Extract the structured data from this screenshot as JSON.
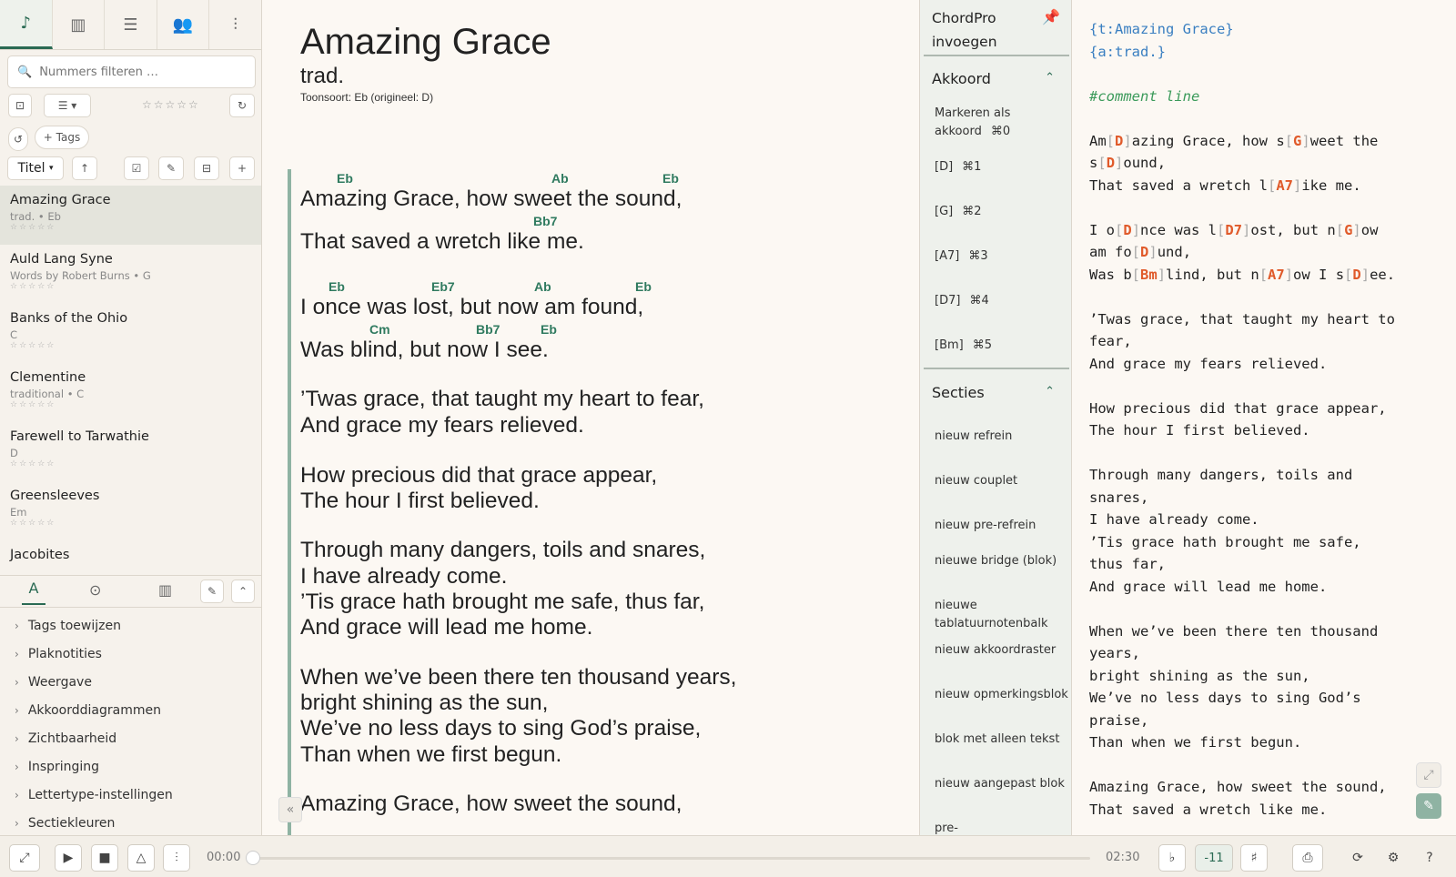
{
  "nav_tabs": [
    {
      "icon": "music-note-icon"
    },
    {
      "icon": "piano-icon"
    },
    {
      "icon": "playlist-icon"
    },
    {
      "icon": "people-icon"
    },
    {
      "icon": "sliders-icon"
    }
  ],
  "search": {
    "placeholder": "Nummers filteren …"
  },
  "toolbar": {
    "tags_label": "+ Tags",
    "sort_label": "Titel"
  },
  "songs": [
    {
      "title": "Amazing Grace",
      "meta": "trad. • Eb",
      "stars": "☆☆☆☆☆"
    },
    {
      "title": "Auld Lang Syne",
      "meta": "Words by Robert Burns • G",
      "stars": "☆☆☆☆☆"
    },
    {
      "title": "Banks of the Ohio",
      "meta": "C",
      "stars": "☆☆☆☆☆"
    },
    {
      "title": "Clementine",
      "meta": "traditional • C",
      "stars": "☆☆☆☆☆"
    },
    {
      "title": "Farewell to Tarwathie",
      "meta": "D",
      "stars": "☆☆☆☆☆"
    },
    {
      "title": "Greensleeves",
      "meta": "Em",
      "stars": "☆☆☆☆☆"
    },
    {
      "title": "Jacobites",
      "meta": "",
      "stars": ""
    }
  ],
  "properties": [
    "Tags toewijzen",
    "Plaknotities",
    "Weergave",
    "Akkoorddiagrammen",
    "Zichtbaarheid",
    "Inspringing",
    "Lettertype-instellingen",
    "Sectiekleuren"
  ],
  "sheet": {
    "title": "Amazing Grace",
    "artist": "trad.",
    "key": "Toonsoort: Eb (origineel: D)",
    "lines": [
      {
        "text": "Amazing Grace, how sweet the sound,",
        "chords": [
          "Eb",
          "Ab",
          "Eb"
        ]
      },
      {
        "text": "That saved a wretch like me.",
        "chords": [
          "Bb7"
        ]
      },
      {
        "text": "I once was lost, but now am found,",
        "chords": [
          "Eb",
          "Eb7",
          "Ab",
          "Eb"
        ]
      },
      {
        "text": "Was blind, but now I see.",
        "chords": [
          "Cm",
          "Bb7",
          "Eb"
        ]
      },
      {
        "text": "’Twas grace, that taught my heart to fear,",
        "chords": []
      },
      {
        "text": "And grace my fears relieved.",
        "chords": []
      },
      {
        "text": "How precious did that grace appear,",
        "chords": []
      },
      {
        "text": "The hour I first believed.",
        "chords": []
      },
      {
        "text": "Through many dangers, toils and snares,",
        "chords": []
      },
      {
        "text": "I have already come.",
        "chords": []
      },
      {
        "text": "’Tis grace hath brought me safe, thus far,",
        "chords": []
      },
      {
        "text": "And grace will lead me home.",
        "chords": []
      },
      {
        "text": "When we’ve been there ten thousand years,",
        "chords": []
      },
      {
        "text": "bright shining as the sun,",
        "chords": []
      },
      {
        "text": "We’ve no less days to sing God’s praise,",
        "chords": []
      },
      {
        "text": "Than when we first begun.",
        "chords": []
      },
      {
        "text": "Amazing Grace, how sweet the sound,",
        "chords": []
      }
    ]
  },
  "insert_panel": {
    "title": "ChordPro invoegen",
    "chord_section": "Akkoord",
    "chord_items": [
      {
        "label": "Markeren als akkoord",
        "shortcut": "⌘0"
      },
      {
        "label": "[D]",
        "shortcut": "⌘1"
      },
      {
        "label": "[G]",
        "shortcut": "⌘2"
      },
      {
        "label": "[A7]",
        "shortcut": "⌘3"
      },
      {
        "label": "[D7]",
        "shortcut": "⌘4"
      },
      {
        "label": "[Bm]",
        "shortcut": "⌘5"
      }
    ],
    "sections_title": "Secties",
    "section_items": [
      "nieuw refrein",
      "nieuw couplet",
      "nieuw pre-refrein",
      "nieuwe bridge (blok)",
      "nieuwe tablatuurnotenbalk",
      "nieuw akkoordraster",
      "nieuw opmerkingsblok",
      "blok met alleen tekst",
      "nieuw aangepast blok",
      "pre-"
    ]
  },
  "source": {
    "directive_title": "{t:Amazing Grace}",
    "directive_artist": "{a:trad.}",
    "comment": "#comment line",
    "tail": "’Twas grace, that taught my heart to\nfear,\nAnd grace my fears relieved.\n\nHow precious did that grace appear,\nThe hour I first believed.\n\nThrough many dangers, toils and\nsnares,\nI have already come.\n’Tis grace hath brought me safe,\nthus far,\nAnd grace will lead me home.\n\nWhen we’ve been there ten thousand\nyears,\nbright shining as the sun,\nWe’ve no less days to sing God’s\npraise,\nThan when we first begun.\n\nAmazing Grace, how sweet the sound,\nThat saved a wretch like me."
  },
  "player": {
    "elapsed": "00:00",
    "total": "02:30",
    "progress": 0,
    "transpose": "-11",
    "flat": "♭",
    "sharp": "♯"
  },
  "colors": {
    "accent": "#2a6a53",
    "chord": "#2f7a5f",
    "chord_src": "#e05a2a",
    "directive": "#3a7fc1",
    "comment": "#3b9a5a"
  }
}
